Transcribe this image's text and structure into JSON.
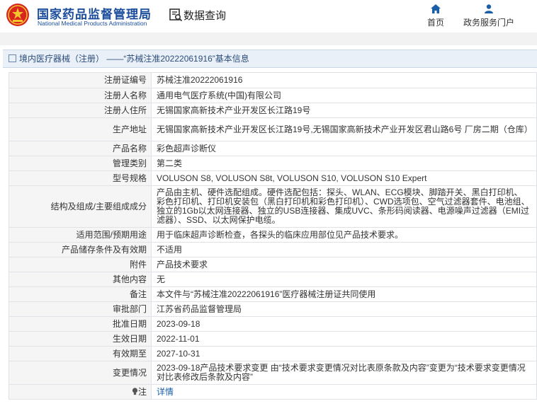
{
  "header": {
    "org_cn": "国家药品监督管理局",
    "org_en": "National Medical Products Administration",
    "query_label": "数据查询",
    "nav": [
      {
        "label": "首页",
        "icon": "home-icon"
      },
      {
        "label": "政务服务门户",
        "icon": "user-icon"
      }
    ]
  },
  "breadcrumb": {
    "text": "境内医疗器械（注册） ——“苏械注准20222061916”基本信息"
  },
  "colors": {
    "brand": "#1b4d9c",
    "label_bg": "#f5f5f5",
    "crumb_bg": "#eaf0f7",
    "link": "#1b5ea8"
  },
  "rows": [
    {
      "label": "注册证编号",
      "value": "苏械注准20222061916"
    },
    {
      "label": "注册人名称",
      "value": "通用电气医疗系统(中国)有限公司"
    },
    {
      "label": "注册人住所",
      "value": "无锡国家高新技术产业开发区长江路19号"
    },
    {
      "label": "生产地址",
      "value": "无锡国家高新技术产业开发区长江路19号,无锡国家高新技术产业开发区君山路6号 厂房二期（仓库）"
    },
    {
      "label": "产品名称",
      "value": "彩色超声诊断仪"
    },
    {
      "label": "管理类别",
      "value": "第二类"
    },
    {
      "label": "型号规格",
      "value": "VOLUSON S8, VOLUSON S8t, VOLUSON S10, VOLUSON S10 Expert"
    },
    {
      "label": "结构及组成/主要组成成分",
      "value": "产品由主机、硬件选配组成。硬件选配包括：探头、WLAN、ECG模块、脚踏开关、黑白打印机、彩色打印机、打印机安装包（黑白打印机和彩色打印机）、CWD选项包、空气过滤器套件、电池组、独立的1Gb以太网连接器、独立的USB连接器、集成UVC、条形码阅读器、电源噪声过滤器（EMI过滤器）、SSD、以太网保护电缆。"
    },
    {
      "label": "适用范围/预期用途",
      "value": "用于临床超声诊断检查，各探头的临床应用部位见产品技术要求。"
    },
    {
      "label": "产品储存条件及有效期",
      "value": "不适用"
    },
    {
      "label": "附件",
      "value": "产品技术要求"
    },
    {
      "label": "其他内容",
      "value": "无"
    },
    {
      "label": "备注",
      "value": "本文件与“苏械注准20222061916”医疗器械注册证共同使用"
    },
    {
      "label": "审批部门",
      "value": "江苏省药品监督管理局"
    },
    {
      "label": "批准日期",
      "value": "2023-09-18"
    },
    {
      "label": "生效日期",
      "value": "2022-11-01"
    },
    {
      "label": "有效期至",
      "value": "2027-10-31"
    },
    {
      "label": "变更情况",
      "value": "2023-09-18产品技术要求变更 由“技术要求变更情况对比表原条款及内容”变更为“技术要求变更情况对比表修改后条款及内容”"
    }
  ],
  "note_row": {
    "label": "注",
    "value": "详情",
    "icon": "bulb-icon"
  }
}
